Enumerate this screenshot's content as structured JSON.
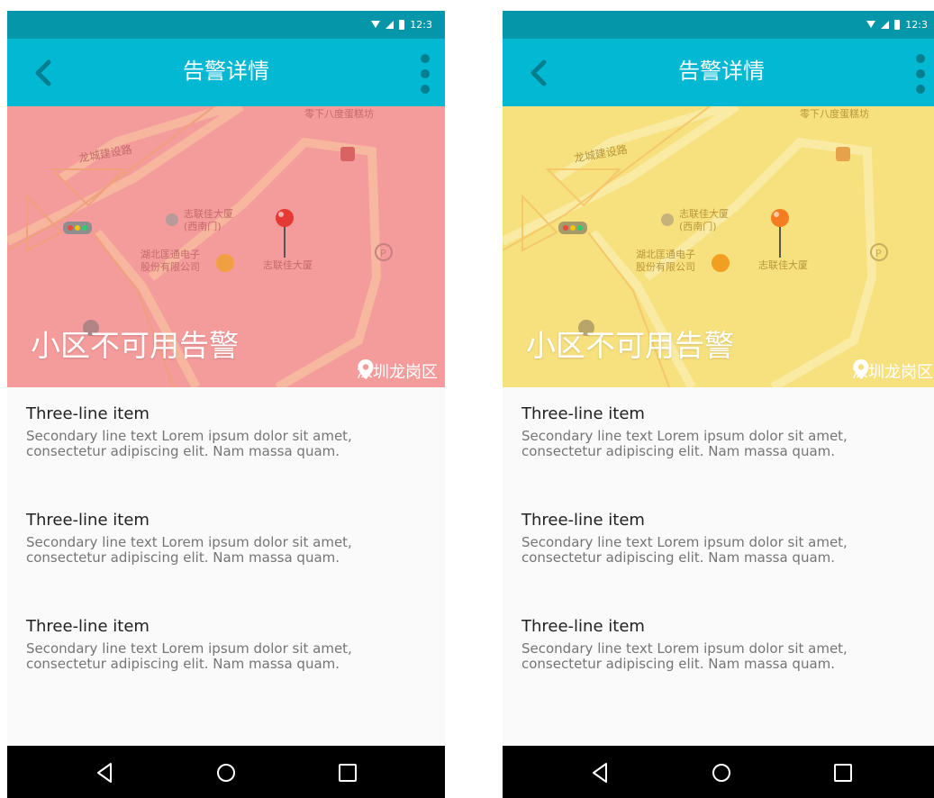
{
  "status_bar": {
    "time": "12:3"
  },
  "screens": [
    {
      "app_bar": {
        "title": "告警详情"
      },
      "hero": {
        "overlay_color": "#f49b9b",
        "title": "小区不可用告警",
        "location": "深圳龙岗区",
        "pin_color": "#e53935",
        "map_labels": {
          "road": "龙城建设路",
          "bakery": "零下八度蛋糕坊",
          "building_west": "志联佳大厦\n(西南门)",
          "company": "湖北匡通电子\n股份有限公司",
          "building": "志联佳大厦"
        }
      },
      "items": [
        {
          "title": "Three-line item",
          "secondary": "Secondary line text Lorem ipsum dolor sit amet, consectetur adipiscing elit. Nam massa quam."
        },
        {
          "title": "Three-line item",
          "secondary": "Secondary line text Lorem ipsum dolor sit amet, consectetur adipiscing elit. Nam massa quam."
        },
        {
          "title": "Three-line item",
          "secondary": "Secondary line text Lorem ipsum dolor sit amet, consectetur adipiscing elit. Nam massa quam."
        }
      ]
    },
    {
      "app_bar": {
        "title": "告警详情"
      },
      "hero": {
        "overlay_color": "#f7e07e",
        "title": "小区不可用告警",
        "location": "深圳龙岗区",
        "pin_color": "#f57c20",
        "map_labels": {
          "road": "龙城建设路",
          "bakery": "零下八度蛋糕坊",
          "building_west": "志联佳大厦\n(西南门)",
          "company": "湖北匡通电子\n股份有限公司",
          "building": "志联佳大厦"
        }
      },
      "items": [
        {
          "title": "Three-line item",
          "secondary": "Secondary line text Lorem ipsum dolor sit amet, consectetur adipiscing elit. Nam massa quam."
        },
        {
          "title": "Three-line item",
          "secondary": "Secondary line text Lorem ipsum dolor sit amet, consectetur adipiscing elit. Nam massa quam."
        },
        {
          "title": "Three-line item",
          "secondary": "Secondary line text Lorem ipsum dolor sit amet, consectetur adipiscing elit. Nam massa quam."
        }
      ]
    }
  ]
}
